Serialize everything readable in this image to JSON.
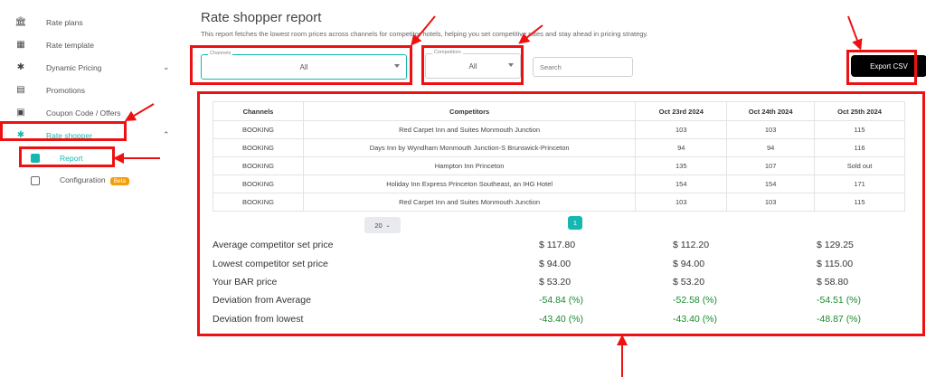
{
  "sidebar": {
    "items": [
      {
        "label": "Rate plans",
        "icon": "bank-icon"
      },
      {
        "label": "Rate template",
        "icon": "grid-icon"
      },
      {
        "label": "Dynamic Pricing",
        "icon": "person-icon"
      },
      {
        "label": "Promotions",
        "icon": "bed-icon"
      },
      {
        "label": "Coupon Code / Offers",
        "icon": "coupon-icon"
      },
      {
        "label": "Rate shopper",
        "icon": "person-icon"
      }
    ],
    "sub": [
      {
        "label": "Report"
      },
      {
        "label": "Configuration",
        "badge": "Beta"
      }
    ]
  },
  "header": {
    "title": "Rate shopper report",
    "subtitle": "This report fetches the lowest room prices across channels for competitor hotels, helping you set competitive rates and stay ahead in pricing strategy."
  },
  "filters": {
    "channels": {
      "label": "Channels",
      "value": "All"
    },
    "competitors": {
      "label": "Competitors",
      "value": "All"
    },
    "search_placeholder": "Search",
    "export_label": "Export CSV"
  },
  "table": {
    "headers": [
      "Channels",
      "Competitors",
      "Oct 23rd 2024",
      "Oct 24th 2024",
      "Oct 25th 2024"
    ],
    "rows": [
      [
        "BOOKING",
        "Red Carpet Inn and Suites Monmouth Junction",
        "103",
        "103",
        "115"
      ],
      [
        "BOOKING",
        "Days Inn by Wyndham Monmouth Junction-S Brunswick-Princeton",
        "94",
        "94",
        "116"
      ],
      [
        "BOOKING",
        "Hampton Inn Princeton",
        "135",
        "107",
        "Sold out"
      ],
      [
        "BOOKING",
        "Holiday Inn Express Princeton Southeast, an IHG Hotel",
        "154",
        "154",
        "171"
      ],
      [
        "BOOKING",
        "Red Carpet Inn and Suites Monmouth Junction",
        "103",
        "103",
        "115"
      ]
    ]
  },
  "pagination": {
    "page_size": "20",
    "current_page": "1"
  },
  "summary": [
    {
      "label": "Average competitor set price",
      "values": [
        "$ 117.80",
        "$ 112.20",
        "$ 129.25"
      ]
    },
    {
      "label": "Lowest competitor set price",
      "values": [
        "$ 94.00",
        "$ 94.00",
        "$ 115.00"
      ]
    },
    {
      "label": "Your BAR price",
      "values": [
        "$ 53.20",
        "$ 53.20",
        "$ 58.80"
      ]
    },
    {
      "label": "Deviation from Average",
      "values": [
        "-54.84 (%)",
        "-52.58 (%)",
        "-54.51 (%)"
      ]
    },
    {
      "label": "Deviation from lowest",
      "values": [
        "-43.40 (%)",
        "-43.40 (%)",
        "-48.87 (%)"
      ]
    }
  ],
  "colors": {
    "accent": "#14b8b0",
    "annotation": "#ee1111",
    "negative": "#1a8a2e",
    "beta": "#f59e0b"
  }
}
